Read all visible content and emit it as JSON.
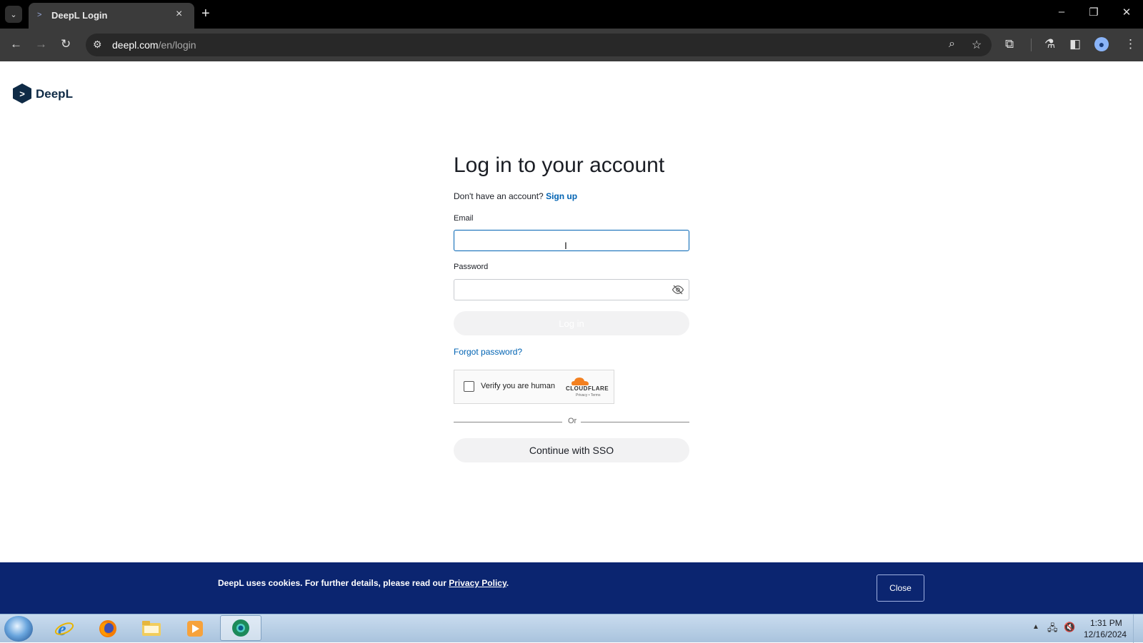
{
  "browser": {
    "tab_title": "DeepL Login",
    "url_host": "deepl.com",
    "url_path": "/en/login",
    "icons": [
      "tab-list-icon",
      "close-icon",
      "plus-icon",
      "minimize-icon",
      "restore-icon",
      "window-close-icon",
      "back-icon",
      "forward-icon",
      "reload-icon",
      "site-info-icon",
      "zoom-icon",
      "star-icon",
      "extensions-icon",
      "labs-icon",
      "sidepanel-icon",
      "profile-icon",
      "menu-icon"
    ]
  },
  "brand": {
    "name": "DeepL",
    "color": "#0f2b46"
  },
  "login": {
    "title": "Log in to your account",
    "signup_prompt": "Don't have an account?",
    "signup_link": "Sign up",
    "email_label": "Email",
    "email_value": "",
    "password_label": "Password",
    "password_value": "",
    "login_button": "Log in",
    "forgot_link": "Forgot password?",
    "divider_text": "Or",
    "sso_button": "Continue with SSO",
    "link_color": "#0063b3"
  },
  "captcha": {
    "label": "Verify you are human",
    "brand": "CLOUDFLARE",
    "links": "Privacy • Terms"
  },
  "cookie_banner": {
    "text": "DeepL uses cookies. For further details, please read our",
    "link": "Privacy Policy",
    "suffix": ".",
    "close_button": "Close",
    "background": "#0b2570"
  },
  "taskbar": {
    "time": "1:31 PM",
    "date": "12/16/2024",
    "apps": [
      "internet-explorer-icon",
      "firefox-icon",
      "file-explorer-icon",
      "media-player-icon",
      "chrome-icon"
    ]
  }
}
